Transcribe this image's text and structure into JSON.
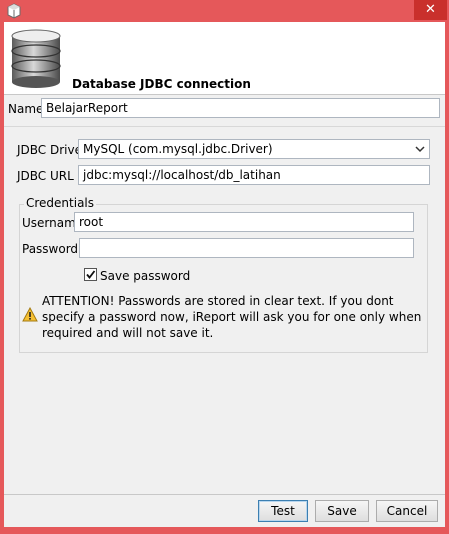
{
  "window": {
    "close_glyph": "✕"
  },
  "banner": {
    "title": "Database JDBC connection",
    "icon": "database-icon"
  },
  "form": {
    "name_label": "Name",
    "name_value": "BelajarReport",
    "driver_label": "JDBC Driver",
    "driver_value": "MySQL (com.mysql.jdbc.Driver)",
    "url_label": "JDBC URL",
    "url_value": "jdbc:mysql://localhost/db_latihan"
  },
  "credentials": {
    "group_title": "Credentials",
    "username_label": "Username",
    "username_value": "root",
    "password_label": "Password",
    "password_value": "",
    "save_password_label": "Save password",
    "save_password_checked": true,
    "warning_text": "ATTENTION! Passwords are stored in clear text. If you dont specify a password now, iReport will ask you for one only when required and will not save it."
  },
  "buttons": {
    "test": "Test",
    "save": "Save",
    "cancel": "Cancel"
  },
  "colors": {
    "window_frame": "#e5585a",
    "close_button": "#c9302c"
  }
}
